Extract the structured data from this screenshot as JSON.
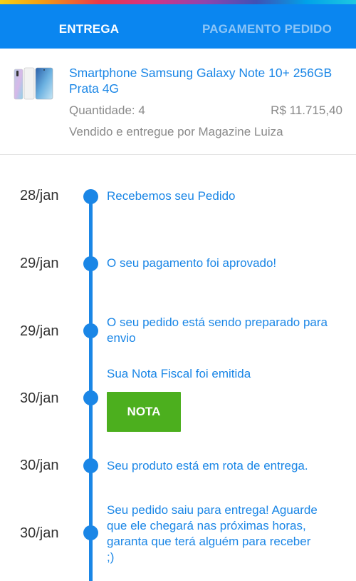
{
  "tabs": [
    {
      "label": "ENTREGA",
      "active": true
    },
    {
      "label": "PAGAMENTO PEDIDO",
      "active": false
    }
  ],
  "product": {
    "name": "Smartphone Samsung Galaxy Note 10+ 256GB Prata 4G",
    "quantity": "Quantidade: 4",
    "price": "R$ 11.715,40",
    "seller": "Vendido e entregue por Magazine Luiza"
  },
  "timeline": [
    {
      "date": "28/jan",
      "text": "Recebemos seu Pedido"
    },
    {
      "date": "29/jan",
      "text": "O seu pagamento foi aprovado!"
    },
    {
      "date": "29/jan",
      "text": "O seu pedido está sendo preparado para envio"
    },
    {
      "date": "30/jan",
      "text": "Sua Nota Fiscal foi emitida",
      "button": "NOTA"
    },
    {
      "date": "30/jan",
      "text": "Seu produto está em rota de entrega."
    },
    {
      "date": "30/jan",
      "text": "Seu pedido saiu para entrega! Aguarde que ele chegará nas próximas horas, garanta que terá alguém para receber ;)"
    }
  ],
  "colors": {
    "primary": "#0a86f0",
    "link": "#1a86e6",
    "button": "#4caf1e",
    "muted": "#8a8a8a"
  }
}
